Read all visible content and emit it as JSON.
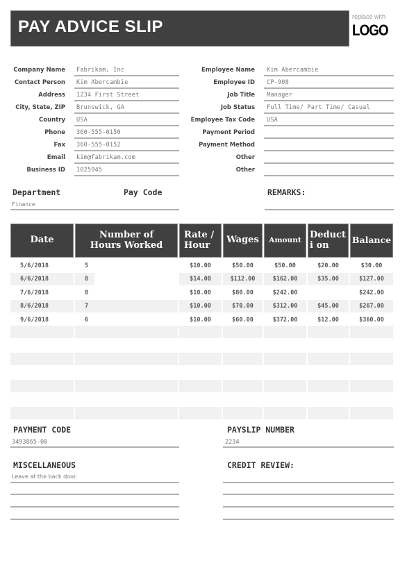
{
  "header": {
    "title": "PAY ADVICE SLIP",
    "logo_hint": "replace with",
    "logo_text": "LOGO"
  },
  "company": [
    {
      "label": "Company Name",
      "value": "Fabrikam, Inc"
    },
    {
      "label": "Contact Person",
      "value": "Kim Abercambie"
    },
    {
      "label": "Address",
      "value": "1234 First Street"
    },
    {
      "label": "City, State, ZIP",
      "value": "Brunswick, GA"
    },
    {
      "label": "Country",
      "value": "USA"
    },
    {
      "label": "Phone",
      "value": "360-555-0150"
    },
    {
      "label": "Fax",
      "value": "360-555-0152"
    },
    {
      "label": "Email",
      "value": "kim@fabrikam.com"
    },
    {
      "label": "Business ID",
      "value": "1025945"
    }
  ],
  "employee": [
    {
      "label": "Employee Name",
      "value": "Kim Abercambie"
    },
    {
      "label": "Employee ID",
      "value": "CP-908"
    },
    {
      "label": "Job Title",
      "value": "Manager"
    },
    {
      "label": "Job Status",
      "value": "Full Time/ Part Time/ Casual"
    },
    {
      "label": "Employee Tax Code",
      "value": "USA"
    },
    {
      "label": "Payment Period",
      "value": ""
    },
    {
      "label": "Payment Method",
      "value": ""
    },
    {
      "label": "Other",
      "value": ""
    },
    {
      "label": "Other",
      "value": ""
    }
  ],
  "department": {
    "label": "Department",
    "value": "Finance"
  },
  "pay_code": {
    "label": "Pay Code",
    "value": ""
  },
  "remarks": {
    "label": "REMARKS:",
    "value": ""
  },
  "table": {
    "columns": [
      "Date",
      "Number of Hours Worked",
      "Rate / Hour",
      "Wages",
      "Amount",
      "Deducti on",
      "Balance"
    ],
    "rows": [
      [
        "5/6/2018",
        "5",
        "$10.00",
        "$50.00",
        "$50.00",
        "$20.00",
        "$30.00"
      ],
      [
        "6/6/2018",
        "8",
        "$14.00",
        "$112.00",
        "$162.00",
        "$35.00",
        "$127.00"
      ],
      [
        "7/6/2018",
        "8",
        "$10.00",
        "$80.00",
        "$242.00",
        "",
        "$242.00"
      ],
      [
        "8/6/2018",
        "7",
        "$10.00",
        "$70.00",
        "$312.00",
        "$45.00",
        "$267.00"
      ],
      [
        "9/6/2018",
        "6",
        "$10.00",
        "$60.00",
        "$372.00",
        "$12.00",
        "$360.00"
      ],
      [
        "",
        "",
        "",
        "",
        "",
        "",
        ""
      ],
      [
        "",
        "",
        "",
        "",
        "",
        "",
        ""
      ],
      [
        "",
        "",
        "",
        "",
        "",
        "",
        ""
      ],
      [
        "",
        "",
        "",
        "",
        "",
        "",
        ""
      ],
      [
        "",
        "",
        "",
        "",
        "",
        "",
        ""
      ],
      [
        "",
        "",
        "",
        "",
        "",
        "",
        ""
      ],
      [
        "",
        "",
        "",
        "",
        "",
        "",
        ""
      ]
    ]
  },
  "payment_code": {
    "label": "PAYMENT CODE",
    "value": "3493865-00"
  },
  "payslip_number": {
    "label": "PAYSLIP NUMBER",
    "value": "2234"
  },
  "miscellaneous": {
    "label": "MISCELLANEOUS",
    "value": "Leave at the back door."
  },
  "credit_review": {
    "label": "CREDIT REVIEW:",
    "value": ""
  }
}
